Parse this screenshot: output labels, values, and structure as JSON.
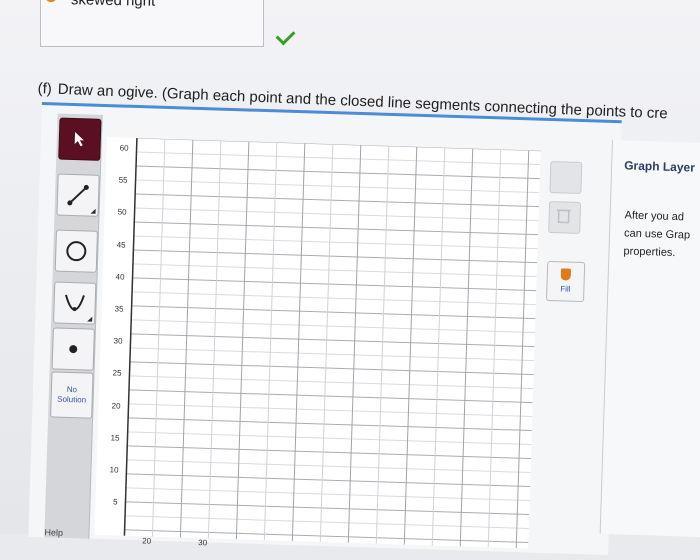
{
  "prev_answer": {
    "text": "skewed right"
  },
  "question": {
    "letter": "(f)",
    "text": "Draw an ogive. (Graph each point and the closed line segments connecting the points to cre"
  },
  "toolbar": {
    "tools": [
      {
        "name": "pointer",
        "icon": "pointer-arrow-icon",
        "active": true
      },
      {
        "name": "line",
        "icon": "line-segment-icon"
      },
      {
        "name": "circle",
        "icon": "circle-icon"
      },
      {
        "name": "parabola",
        "icon": "parabola-icon"
      },
      {
        "name": "point",
        "icon": "point-icon"
      }
    ],
    "no_solution_line1": "No",
    "no_solution_line2": "Solution",
    "help_label": "Help"
  },
  "graph": {
    "y_ticks": [
      "60",
      "55",
      "50",
      "45",
      "40",
      "35",
      "30",
      "25",
      "20",
      "15",
      "10",
      "5"
    ],
    "x_ticks": [
      "20",
      "30"
    ]
  },
  "side_tools": {
    "fill_label": "Fill"
  },
  "layer_panel": {
    "title": "Graph Layer",
    "hint_line1": "After you ad",
    "hint_line2": "can use Grap",
    "hint_line3": "properties."
  },
  "colors": {
    "accent": "#4c8bd6",
    "active_tool": "#5a1020",
    "radio": "#e87d18",
    "check": "#33a02c"
  }
}
